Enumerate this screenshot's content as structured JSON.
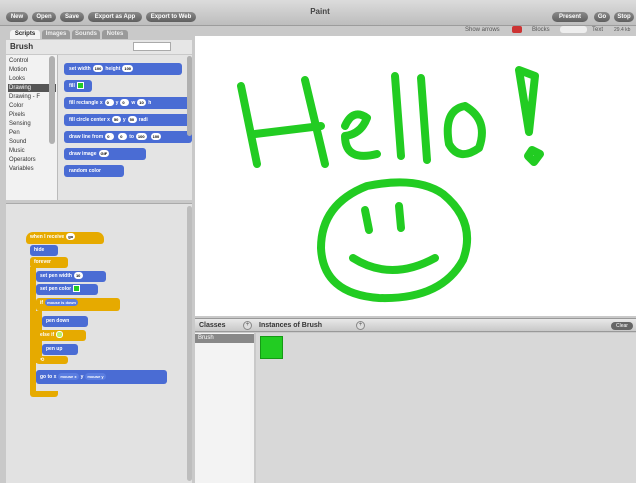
{
  "window": {
    "title": "Paint"
  },
  "toolbar": {
    "new_label": "New",
    "open_label": "Open",
    "save_label": "Save",
    "export_app_label": "Export as App",
    "export_web_label": "Export to Web",
    "present_label": "Present",
    "go_label": "Go",
    "stop_label": "Stop"
  },
  "options": {
    "show_arrows_label": "Show arrows",
    "blocks_label": "Blocks",
    "text_label": "Text",
    "memory_label": "29.4 kb"
  },
  "tabs": [
    {
      "label": "Scripts"
    },
    {
      "label": "Images"
    },
    {
      "label": "Sounds"
    },
    {
      "label": "Notes"
    }
  ],
  "palette": {
    "title": "Brush",
    "categories": [
      "Control",
      "Motion",
      "Looks",
      "Drawing",
      "Drawing - F",
      "Color",
      "Pixels",
      "Sensing",
      "Pen",
      "Sound",
      "Music",
      "Operators",
      "Variables"
    ],
    "selected_category": "Drawing"
  },
  "palette_blocks": [
    {
      "text": "set width",
      "in1": "100",
      "text2": "height",
      "in2": "100"
    },
    {
      "text": "fill",
      "color": "#22cc22"
    },
    {
      "text": "fill rectangle x",
      "in1": "0",
      "text2": "y",
      "in2": "0",
      "text3": "w",
      "in3": "10",
      "text4": "h"
    },
    {
      "text": "fill circle center x",
      "in1": "50",
      "text2": "y",
      "in2": "50",
      "text3": "radi"
    },
    {
      "text": "draw line from",
      "in1": "0",
      "in2": "0",
      "text2": "to",
      "in3": "100",
      "in4": "100"
    },
    {
      "text": "draw image",
      "in1": "GIF"
    },
    {
      "text": "random color"
    }
  ],
  "script": {
    "hat": {
      "text": "when I receive",
      "arg": "go"
    },
    "hide": "hide",
    "forever": "forever",
    "set_pen_width": {
      "text": "set pen width",
      "arg": "10"
    },
    "set_pen_color": {
      "text": "set pen color"
    },
    "if_label": "if",
    "condition": "mouse is down",
    "pen_down": "pen down",
    "else_if": "else if",
    "pen_up": "pen up",
    "loop": "⟲",
    "goto": {
      "text": "go to x",
      "x": "mouse x",
      "y_label": "y",
      "y": "mouse y"
    }
  },
  "stage": {
    "drawing_text": "Hello!",
    "pen_color": "#22cc22"
  },
  "classes": {
    "label": "Classes",
    "items": [
      "Brush"
    ]
  },
  "instances": {
    "label": "Instances of Brush",
    "clear_label": "Clear",
    "swatch_color": "#22cc22"
  },
  "colors": {
    "accent": "#22cc22",
    "motion_blue": "#4a6cd4",
    "control_yellow": "#e6aa00"
  }
}
